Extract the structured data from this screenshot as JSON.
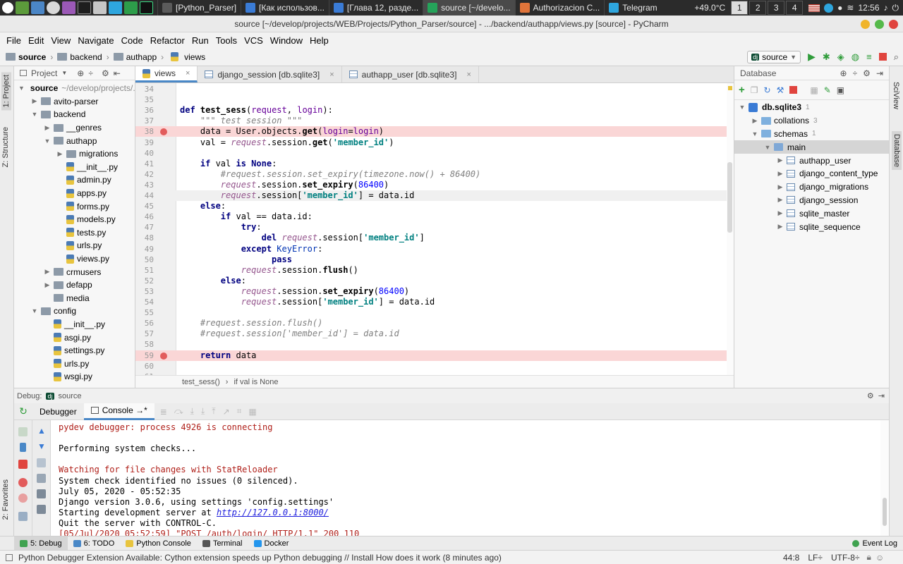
{
  "taskbar": {
    "tasks": [
      {
        "label": "[Python_Parser]",
        "color": "#5b5b5b",
        "active": false
      },
      {
        "label": "[Как использов...",
        "color": "#3a7bd5",
        "active": false
      },
      {
        "label": "[Глава 12, разде...",
        "color": "#3a7bd5",
        "active": false
      },
      {
        "label": "source [~/develo...",
        "color": "#25a35a",
        "active": true
      },
      {
        "label": "Authorizacion C...",
        "color": "#e0743a",
        "active": false
      },
      {
        "label": "Telegram",
        "color": "#2ea6de",
        "active": false
      }
    ],
    "temperature": "+49.0°C",
    "workspaces": [
      "1",
      "2",
      "3",
      "4"
    ],
    "active_workspace": "1",
    "clock": "12:56"
  },
  "window": {
    "title": "source [~/develop/projects/WEB/Projects/Python_Parser/source] - .../backend/authapp/views.py [source] - PyCharm"
  },
  "menu": [
    "File",
    "Edit",
    "View",
    "Navigate",
    "Code",
    "Refactor",
    "Run",
    "Tools",
    "VCS",
    "Window",
    "Help"
  ],
  "breadcrumbs": [
    "source",
    "backend",
    "authapp",
    "views"
  ],
  "run_config": "source",
  "left_tabs": {
    "project": "1: Project",
    "structure": "Z: Structure",
    "favorites": "2: Favorites"
  },
  "project_panel": {
    "title": "Project",
    "tree": [
      {
        "label": "source",
        "suffix": "~/develop/projects/...",
        "depth": 0,
        "type": "folder",
        "open": true,
        "bold": true
      },
      {
        "label": "avito-parser",
        "depth": 1,
        "type": "folder",
        "open": false
      },
      {
        "label": "backend",
        "depth": 1,
        "type": "folder",
        "open": true
      },
      {
        "label": "__genres",
        "depth": 2,
        "type": "folder",
        "open": false
      },
      {
        "label": "authapp",
        "depth": 2,
        "type": "folder",
        "open": true
      },
      {
        "label": "migrations",
        "depth": 3,
        "type": "folder",
        "open": false
      },
      {
        "label": "__init__.py",
        "depth": 3,
        "type": "file"
      },
      {
        "label": "admin.py",
        "depth": 3,
        "type": "file"
      },
      {
        "label": "apps.py",
        "depth": 3,
        "type": "file"
      },
      {
        "label": "forms.py",
        "depth": 3,
        "type": "file"
      },
      {
        "label": "models.py",
        "depth": 3,
        "type": "file"
      },
      {
        "label": "tests.py",
        "depth": 3,
        "type": "file"
      },
      {
        "label": "urls.py",
        "depth": 3,
        "type": "file"
      },
      {
        "label": "views.py",
        "depth": 3,
        "type": "file"
      },
      {
        "label": "crmusers",
        "depth": 2,
        "type": "folder",
        "open": false
      },
      {
        "label": "defapp",
        "depth": 2,
        "type": "folder",
        "open": false
      },
      {
        "label": "media",
        "depth": 2,
        "type": "folder",
        "open": null
      },
      {
        "label": "config",
        "depth": 1,
        "type": "folder",
        "open": true
      },
      {
        "label": "__init__.py",
        "depth": 2,
        "type": "file"
      },
      {
        "label": "asgi.py",
        "depth": 2,
        "type": "file"
      },
      {
        "label": "settings.py",
        "depth": 2,
        "type": "file"
      },
      {
        "label": "urls.py",
        "depth": 2,
        "type": "file"
      },
      {
        "label": "wsgi.py",
        "depth": 2,
        "type": "file"
      }
    ]
  },
  "editor_tabs": [
    {
      "label": "views",
      "kind": "py",
      "active": true
    },
    {
      "label": "django_session [db.sqlite3]",
      "kind": "table",
      "active": false
    },
    {
      "label": "authapp_user [db.sqlite3]",
      "kind": "table",
      "active": false
    }
  ],
  "code_lines": [
    {
      "n": "34",
      "html": ""
    },
    {
      "n": "35",
      "html": ""
    },
    {
      "n": "36",
      "html": "<span class='kw'>def</span> <span class='fn'>test_sess</span>(<span class='par'>request</span>, <span class='par'>login</span>):"
    },
    {
      "n": "37",
      "html": "    <span class='cm'>\"\"\" test session \"\"\"</span>"
    },
    {
      "n": "38",
      "html": "    data = User.objects.<span class='fn'>get</span>(<span class='par'>login</span>=<span class='par'>login</span>)",
      "bp": true
    },
    {
      "n": "39",
      "html": "    val = <span class='self'>request</span>.session.<span class='fn'>get</span>(<span class='str'>'member_id'</span>)"
    },
    {
      "n": "40",
      "html": ""
    },
    {
      "n": "41",
      "html": "    <span class='kw'>if</span> val <span class='kw'>is None</span>:"
    },
    {
      "n": "42",
      "html": "        <span class='cm'>#request.session.set_expiry(timezone.now() + 86400)</span>"
    },
    {
      "n": "43",
      "html": "        <span class='self'>request</span>.session.<span class='fn'>set_expiry</span>(<span class='num'>86400</span>)"
    },
    {
      "n": "44",
      "html": "        <span class='self'>request</span>.session[<span class='str'>'member_id'</span>] = data.id",
      "current": true
    },
    {
      "n": "45",
      "html": "    <span class='kw'>else</span>:"
    },
    {
      "n": "46",
      "html": "        <span class='kw'>if</span> val == data.id:"
    },
    {
      "n": "47",
      "html": "            <span class='kw'>try</span>:"
    },
    {
      "n": "48",
      "html": "                <span class='kw'>del</span> <span class='self'>request</span>.session[<span class='str'>'member_id'</span>]"
    },
    {
      "n": "49",
      "html": "            <span class='kw'>except</span> <span class='cls'>KeyError</span>:"
    },
    {
      "n": "50",
      "html": "                  <span class='kw'>pass</span>"
    },
    {
      "n": "51",
      "html": "            <span class='self'>request</span>.session.<span class='fn'>flush</span>()"
    },
    {
      "n": "52",
      "html": "        <span class='kw'>else</span>:"
    },
    {
      "n": "53",
      "html": "            <span class='self'>request</span>.session.<span class='fn'>set_expiry</span>(<span class='num'>86400</span>)"
    },
    {
      "n": "54",
      "html": "            <span class='self'>request</span>.session[<span class='str'>'member_id'</span>] = data.id"
    },
    {
      "n": "55",
      "html": ""
    },
    {
      "n": "56",
      "html": "    <span class='cm'>#request.session.flush()</span>"
    },
    {
      "n": "57",
      "html": "    <span class='cm'>#request.session['member_id'] = data.id</span>"
    },
    {
      "n": "58",
      "html": ""
    },
    {
      "n": "59",
      "html": "    <span class='kw'>return</span> data",
      "bp": true
    },
    {
      "n": "60",
      "html": ""
    },
    {
      "n": "61",
      "html": ""
    }
  ],
  "editor_breadcrumbs": [
    "test_sess()",
    "if val is None"
  ],
  "database_panel": {
    "title": "Database",
    "tree": [
      {
        "label": "db.sqlite3",
        "count": "1",
        "depth": 0,
        "type": "db",
        "open": true,
        "bold": true
      },
      {
        "label": "collations",
        "count": "3",
        "depth": 1,
        "type": "folder",
        "open": false
      },
      {
        "label": "schemas",
        "count": "1",
        "depth": 1,
        "type": "folder",
        "open": true
      },
      {
        "label": "main",
        "depth": 2,
        "type": "schema",
        "open": true,
        "selected": true
      },
      {
        "label": "authapp_user",
        "depth": 3,
        "type": "table",
        "open": false
      },
      {
        "label": "django_content_type",
        "depth": 3,
        "type": "table",
        "open": false
      },
      {
        "label": "django_migrations",
        "depth": 3,
        "type": "table",
        "open": false
      },
      {
        "label": "django_session",
        "depth": 3,
        "type": "table",
        "open": false
      },
      {
        "label": "sqlite_master",
        "depth": 3,
        "type": "table",
        "open": false
      },
      {
        "label": "sqlite_sequence",
        "depth": 3,
        "type": "table",
        "open": false
      }
    ]
  },
  "right_tabs": {
    "sciview": "SciView",
    "database": "Database"
  },
  "debug": {
    "label": "Debug:",
    "config": "source",
    "tabs": [
      {
        "label": "Debugger",
        "active": false
      },
      {
        "label": "Console →*",
        "active": true
      }
    ]
  },
  "console_lines": [
    {
      "text": "pydev debugger: process 4926 is connecting",
      "style": "red"
    },
    {
      "text": "",
      "style": "plain"
    },
    {
      "text": "Performing system checks...",
      "style": "plain"
    },
    {
      "text": "",
      "style": "plain"
    },
    {
      "text": "Watching for file changes with StatReloader",
      "style": "red"
    },
    {
      "text": "System check identified no issues (0 silenced).",
      "style": "plain"
    },
    {
      "text": "July 05, 2020 - 05:52:35",
      "style": "plain"
    },
    {
      "text": "Django version 3.0.6, using settings 'config.settings'",
      "style": "plain"
    },
    {
      "text": "Starting development server at ",
      "link": "http://127.0.0.1:8000/",
      "style": "plain"
    },
    {
      "text": "Quit the server with CONTROL-C.",
      "style": "plain"
    },
    {
      "text": "[05/Jul/2020 05:52:59] \"POST /auth/login/ HTTP/1.1\" 200 110",
      "style": "red"
    }
  ],
  "bottom_tools": [
    {
      "label": "5: Debug",
      "icon": "bug-icon",
      "active": true
    },
    {
      "label": "6: TODO",
      "icon": "todo-icon",
      "active": false
    },
    {
      "label": "Python Console",
      "icon": "python-icon",
      "active": false
    },
    {
      "label": "Terminal",
      "icon": "terminal-icon",
      "active": false
    },
    {
      "label": "Docker",
      "icon": "docker-icon",
      "active": false
    }
  ],
  "event_log": "Event Log",
  "status": {
    "message": "Python Debugger Extension Available: Cython extension speeds up Python debugging // Install How does it work (8 minutes ago)",
    "position": "44:8",
    "line_sep": "LF÷",
    "encoding": "UTF-8÷"
  },
  "colors": {
    "accent": "#4a88c7",
    "breakpoint": "#e25c5c",
    "breakpoint_line": "#fad6d6",
    "run_green": "#2f9c3a"
  }
}
